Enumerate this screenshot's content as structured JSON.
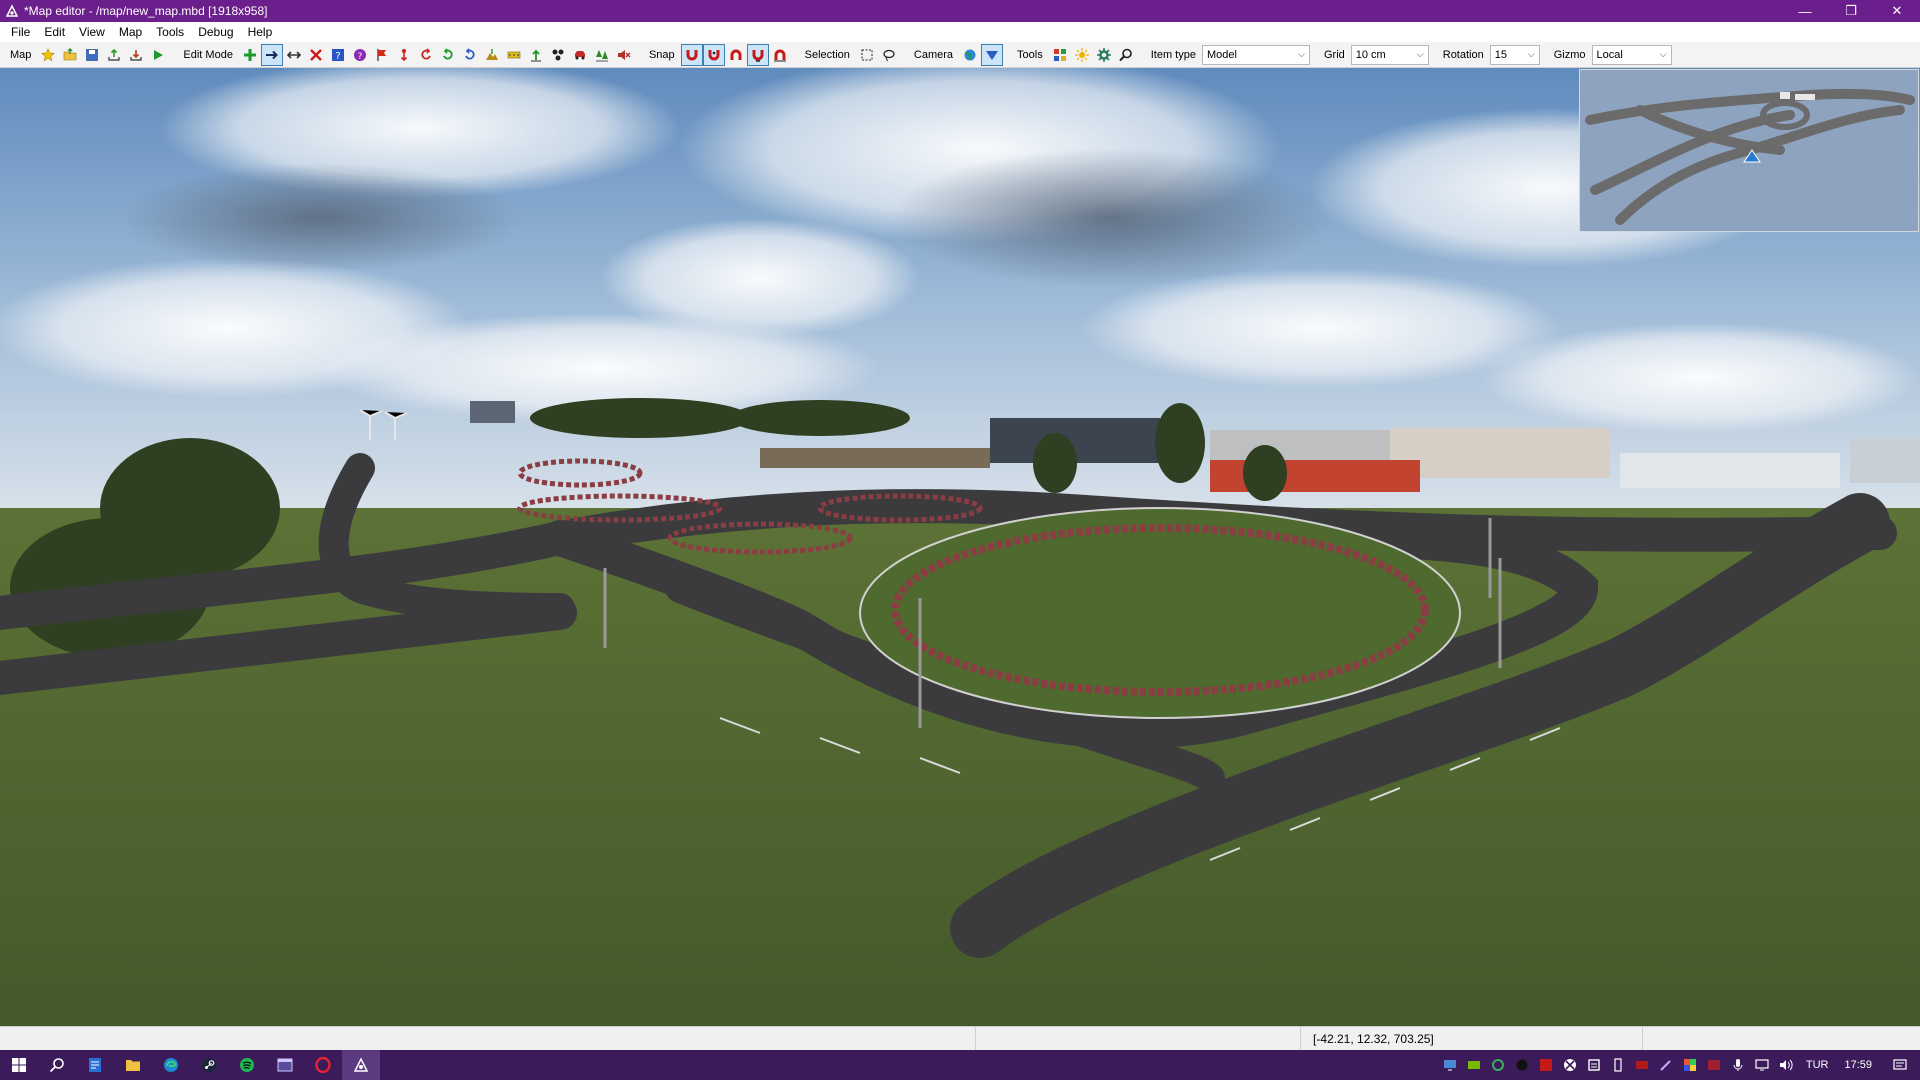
{
  "window": {
    "title": "*Map editor - /map/new_map.mbd [1918x958]",
    "controls": [
      "minimize",
      "restore",
      "close"
    ]
  },
  "menu": {
    "items": [
      {
        "label": "File"
      },
      {
        "label": "Edit"
      },
      {
        "label": "View"
      },
      {
        "label": "Map"
      },
      {
        "label": "Tools"
      },
      {
        "label": "Debug"
      },
      {
        "label": "Help"
      }
    ]
  },
  "toolbar": {
    "map_label": "Map",
    "edit_mode_label": "Edit Mode",
    "snap_label": "Snap",
    "selection_label": "Selection",
    "camera_label": "Camera",
    "tools_label": "Tools",
    "item_type_label": "Item type",
    "item_type_value": "Model",
    "grid_label": "Grid",
    "grid_value": "10 cm",
    "rotation_label": "Rotation",
    "rotation_value": "15",
    "gizmo_label": "Gizmo",
    "gizmo_value": "Local"
  },
  "status": {
    "coordinates": "[-42.21, 12.32, 703.25]"
  },
  "taskbar": {
    "language": "TUR",
    "time": "17:59"
  },
  "colors": {
    "titlebar": "#6b1f8c",
    "taskbar": "#3b1b5a",
    "grass": "#4f6a2e",
    "road": "#3a3a3c",
    "sky": "#7aa2cc"
  }
}
